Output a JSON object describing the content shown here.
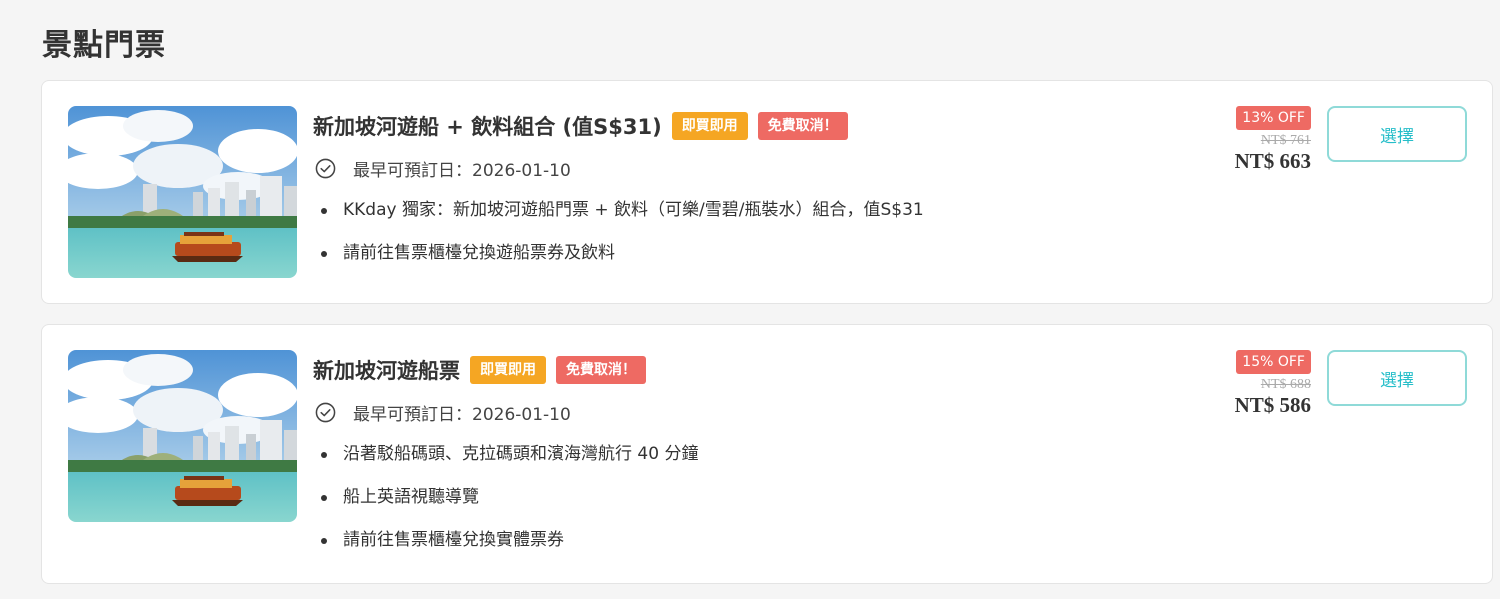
{
  "section_title": "景點門票",
  "products": [
    {
      "title": "新加坡河遊船 + 飲料組合 (值S$31)",
      "badges": [
        "即買即用",
        "免費取消！"
      ],
      "earliest_date": "最早可預訂日：2026-01-10",
      "bullets": [
        "KKday 獨家：新加坡河遊船門票 + 飲料（可樂/雪碧/瓶裝水）組合，值S$31",
        "請前往售票櫃檯兌換遊船票券及飲料"
      ],
      "discount": "13% OFF",
      "original_price": "NT$ 761",
      "price": "NT$ 663",
      "button": "選擇"
    },
    {
      "title": "新加坡河遊船票",
      "badges": [
        "即買即用",
        "免費取消！"
      ],
      "earliest_date": "最早可預訂日：2026-01-10",
      "bullets": [
        "沿著駁船碼頭、克拉碼頭和濱海灣航行 40 分鐘",
        "船上英語視聽導覽",
        "請前往售票櫃檯兌換實體票券"
      ],
      "discount": "15% OFF",
      "original_price": "NT$ 688",
      "price": "NT$ 586",
      "button": "選擇"
    }
  ],
  "icons": {
    "check": "check-circle-icon"
  },
  "colors": {
    "badge_instant": "#f5a623",
    "badge_cancel": "#ee6a63",
    "button_text": "#26bec9",
    "button_border": "#8fdad8"
  }
}
